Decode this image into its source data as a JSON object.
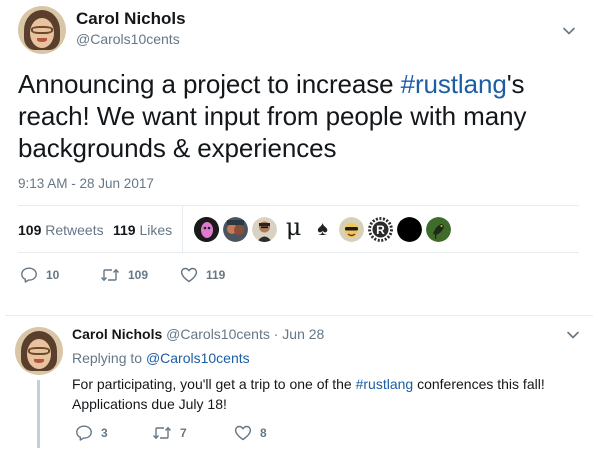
{
  "main_tweet": {
    "author": {
      "name": "Carol Nichols",
      "handle": "@Carols10cents"
    },
    "text": {
      "before_hashtag": "Announcing a project to increase ",
      "hashtag": "#rustlang",
      "after_hashtag": "'s reach! We want input from people with many backgrounds & experiences"
    },
    "timestamp": "9:13 AM - 28 Jun 2017",
    "stats": {
      "retweets_count": "109",
      "retweets_label": "Retweets",
      "likes_count": "119",
      "likes_label": "Likes"
    },
    "likers": [
      "liker-1",
      "liker-2",
      "liker-3",
      "liker-mu",
      "liker-spade",
      "liker-5",
      "liker-rust",
      "liker-black",
      "liker-bird"
    ],
    "mu_glyph": "μ",
    "spade_glyph": "♠",
    "actions": {
      "reply_count": "10",
      "retweet_count": "109",
      "like_count": "119"
    }
  },
  "reply_tweet": {
    "author": {
      "name": "Carol Nichols",
      "handle": "@Carols10cents",
      "date": "· Jun 28"
    },
    "replying_label": "Replying to",
    "replying_to": "@Carols10cents",
    "text": {
      "before_hashtag": "For participating, you'll get a trip to one of the ",
      "hashtag": "#rustlang",
      "after_hashtag": " conferences this fall! Applications due July 18!"
    },
    "actions": {
      "reply_count": "3",
      "retweet_count": "7",
      "like_count": "8"
    }
  },
  "colors": {
    "link": "#1b5ea6",
    "muted": "#657786",
    "text": "#14171a",
    "border": "#e6ecf0"
  }
}
